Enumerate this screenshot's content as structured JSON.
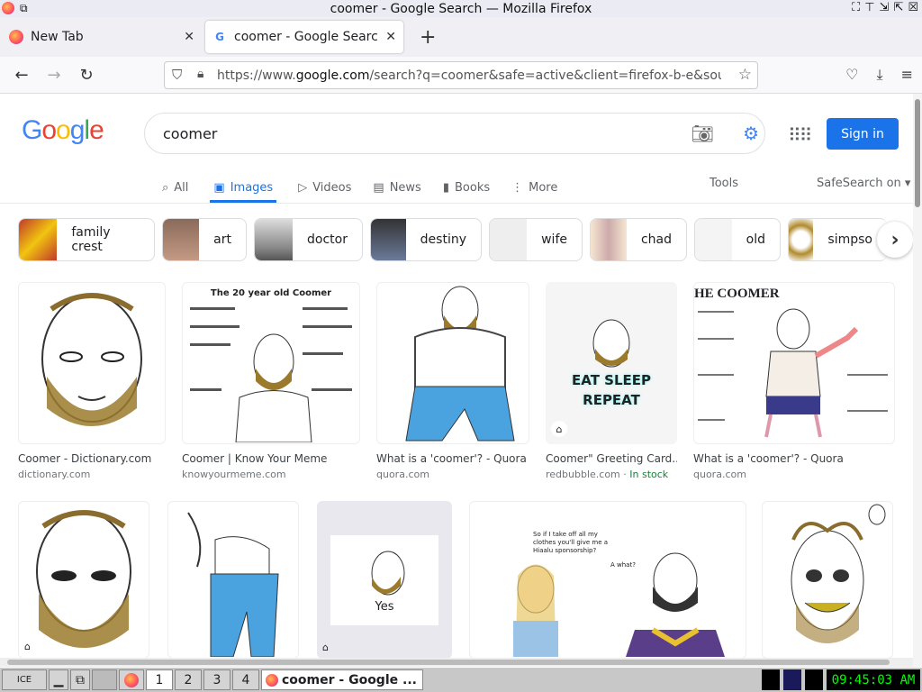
{
  "window": {
    "title": "coomer - Google Search — Mozilla Firefox"
  },
  "tabs": [
    {
      "label": "New Tab",
      "active": false
    },
    {
      "label": "coomer - Google Search",
      "active": true
    }
  ],
  "url": {
    "prefix": "https://www.",
    "domain": "google.com",
    "rest": "/search?q=coomer&safe=active&client=firefox-b-e&sou"
  },
  "google": {
    "query": "coomer",
    "sign_in": "Sign in",
    "tabs": [
      "All",
      "Images",
      "Videos",
      "News",
      "Books",
      "More"
    ],
    "tools": "Tools",
    "safesearch": "SafeSearch on"
  },
  "chips": [
    "family crest",
    "art",
    "doctor",
    "destiny",
    "wife",
    "chad",
    "old",
    "simpso"
  ],
  "results": [
    {
      "title": "Coomer - Dictionary.com",
      "source": "dictionary.com",
      "extra": ""
    },
    {
      "title": "Coomer | Know Your Meme",
      "source": "knowyourmeme.com",
      "extra": "",
      "caption": "The 20 year old Coomer"
    },
    {
      "title": "What is a 'coomer'? - Quora",
      "source": "quora.com",
      "extra": ""
    },
    {
      "title": "Coomer\" Greeting Card...",
      "source": "redbubble.com",
      "extra": "In stock",
      "caption": "EAT SLEEP REPEAT"
    },
    {
      "title": "What is a 'coomer'? - Quora",
      "source": "quora.com",
      "extra": "",
      "caption": "HE COOMER"
    }
  ],
  "row2": [
    {
      "caption": ""
    },
    {
      "caption": ""
    },
    {
      "caption": "Yes"
    },
    {
      "caption": "So if I take off all my clothes you'll give me a Hiaalu sponsorship?"
    },
    {
      "caption": ""
    }
  ],
  "row2_extra": "A what?",
  "taskbar": {
    "workspaces": [
      "1",
      "2",
      "3",
      "4"
    ],
    "task_label": "coomer - Google ...",
    "clock": "09:45:03 AM"
  }
}
